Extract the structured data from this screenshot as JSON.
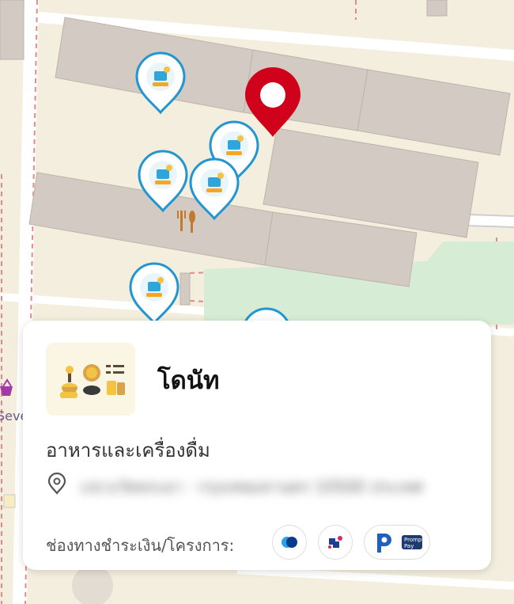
{
  "shop": {
    "name": "โดนัท",
    "category": "อาหารและเครื่องดื่ม",
    "address_blurred": "แขวงวัดพระยา · กรุงเทพมหานคร 10500 ประเทศ"
  },
  "payment": {
    "label": "ช่องทางชำระเงิน/โครงการ:",
    "channels": [
      "e-wallet-icon",
      "tourist-scheme-icon",
      "promptpay-icon"
    ],
    "promptpay_text_1": "Prompt",
    "promptpay_text_2": "Pay"
  },
  "map": {
    "partial_store_label": "Seven"
  },
  "colors": {
    "selected_pin": "#d0021b",
    "marker_border": "#2196d3",
    "promptpay_blue": "#1e5fbf"
  }
}
